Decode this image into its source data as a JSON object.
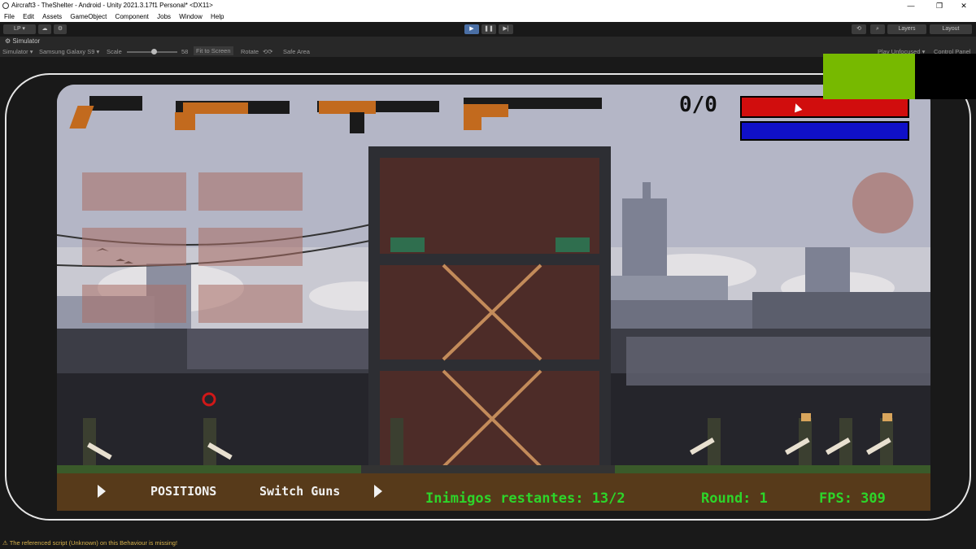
{
  "window": {
    "title": "Aircraft3 - TheShelter - Android - Unity 2021.3.17f1 Personal* <DX11>",
    "controls": [
      "—",
      "❐",
      "✕"
    ]
  },
  "menu": [
    "File",
    "Edit",
    "Assets",
    "GameObject",
    "Component",
    "Jobs",
    "Window",
    "Help"
  ],
  "toolbar": {
    "account": "LP ▾",
    "layers": "Layers",
    "layout": "Layout",
    "play": "▶",
    "pause": "❚❚",
    "step": "▶|"
  },
  "tab": {
    "label": "Simulator"
  },
  "simulator": {
    "mode": "Simulator ▾",
    "device": "Samsung Galaxy S9 ▾",
    "scale_label": "Scale",
    "scale_value": "58",
    "fit": "Fit to Screen",
    "rotate": "Rotate",
    "safe_area": "Safe Area",
    "play_mode": "Play Unfocused ▾",
    "control_panel": "Control Panel"
  },
  "hud": {
    "ammo": "0/0",
    "health_level": 1.0,
    "shield_level": 1.0,
    "positions": "POSITIONS",
    "switch_guns": "Switch Guns",
    "enemies": "Inimigos restantes: 13/2",
    "round": "Round: 1",
    "fps": "FPS: 309"
  },
  "status": {
    "message": "The referenced script (Unknown) on this Behaviour is missing!"
  },
  "colors": {
    "health": "#d10d0d",
    "shield": "#1010c8",
    "hud_green": "#2dd52a",
    "overlay_green": "#77b900"
  }
}
